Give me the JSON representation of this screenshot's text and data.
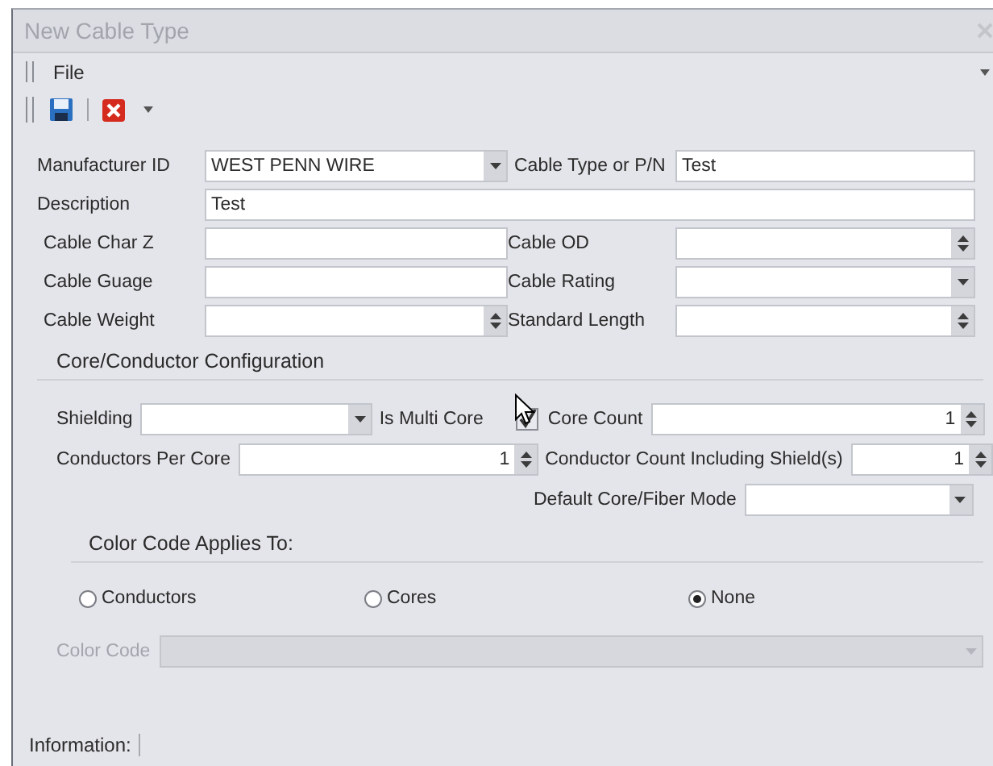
{
  "window": {
    "title": "New Cable Type"
  },
  "menu": [
    "File"
  ],
  "form": {
    "rows": [
      [
        {
          "label": "Manufacturer ID",
          "kind": "combo",
          "value": "WEST PENN WIRE"
        },
        {
          "label": "Cable Type or P/N",
          "kind": "text",
          "value": "Test"
        }
      ],
      [
        {
          "label": "Description",
          "kind": "text",
          "value": "Test"
        }
      ],
      [
        {
          "label": "Cable Char Z",
          "kind": "text"
        },
        {
          "label": "Cable OD",
          "kind": "spin"
        }
      ],
      [
        {
          "label": "Cable Guage",
          "kind": "text"
        },
        {
          "label": "Cable Rating",
          "kind": "combo"
        }
      ],
      [
        {
          "label": "Cable Weight",
          "kind": "spin"
        },
        {
          "label": "Standard Length",
          "kind": "spin"
        }
      ]
    ]
  },
  "core_config": {
    "title": "Core/Conductor Configuration",
    "shielding": {
      "label": "Shielding"
    },
    "multi_core": {
      "label": "Is Multi Core",
      "checked": true
    },
    "core_count": {
      "label": "Core Count",
      "value": "1"
    },
    "conductors_per_core": {
      "label": "Conductors Per Core",
      "value": "1"
    },
    "conductor_count": {
      "label": "Conductor Count Including Shield(s)",
      "value": "1"
    },
    "default_mode": {
      "label": "Default Core/Fiber Mode"
    }
  },
  "color_code": {
    "title": "Color Code Applies To:",
    "options": [
      {
        "label": "Conductors",
        "selected": false
      },
      {
        "label": "Cores",
        "selected": false
      },
      {
        "label": "None",
        "selected": true
      }
    ],
    "field": {
      "label": "Color Code",
      "disabled": true
    }
  },
  "status_bar": {
    "label": "Information:"
  }
}
